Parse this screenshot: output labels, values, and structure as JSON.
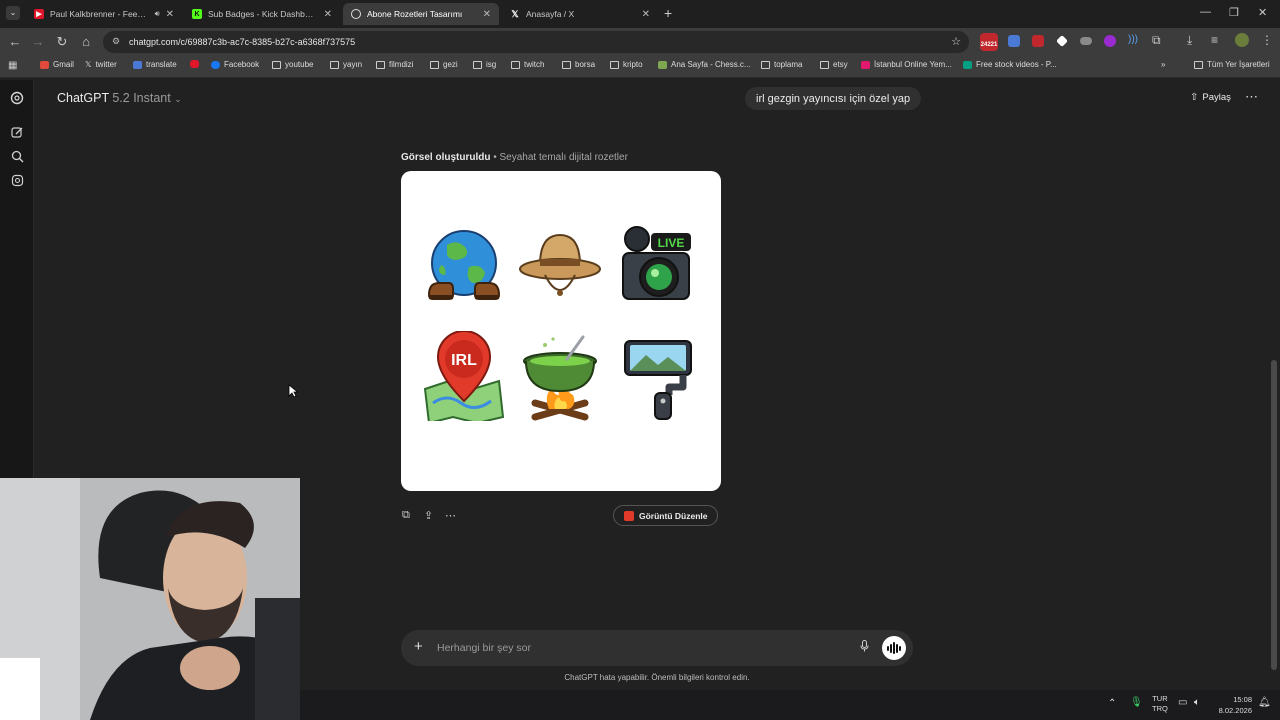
{
  "browser": {
    "tabs": [
      {
        "title": "Paul Kalkbrenner - Feed Yo",
        "favicon_color": "#e0162b",
        "active": false
      },
      {
        "title": "Sub Badges - Kick Dashboard",
        "favicon_color": "#53fc18",
        "active": false
      },
      {
        "title": "Abone Rozetleri Tasarımı",
        "favicon_color": "#ffffff",
        "active": true
      },
      {
        "title": "Anasayfa / X",
        "favicon_color": "#ffffff",
        "active": false
      }
    ],
    "url": "chatgpt.com/c/69887c3b-ac7c-8385-b27c-a6368f737575",
    "extension_badge": "24221",
    "bookmarks": [
      {
        "label": "Gmail",
        "icon": "gmail-icon"
      },
      {
        "label": "twitter",
        "icon": "x-icon"
      },
      {
        "label": "translate",
        "icon": "translate-icon"
      },
      {
        "label": "",
        "icon": "youtube-icon"
      },
      {
        "label": "Facebook",
        "icon": "facebook-icon"
      },
      {
        "label": "youtube",
        "icon": "folder-icon"
      },
      {
        "label": "yayın",
        "icon": "folder-icon"
      },
      {
        "label": "filmdizi",
        "icon": "folder-icon"
      },
      {
        "label": "gezi",
        "icon": "folder-icon"
      },
      {
        "label": "isg",
        "icon": "folder-icon"
      },
      {
        "label": "twitch",
        "icon": "folder-icon"
      },
      {
        "label": "borsa",
        "icon": "folder-icon"
      },
      {
        "label": "kripto",
        "icon": "folder-icon"
      },
      {
        "label": "Ana Sayfa - Chess.c...",
        "icon": "chess-icon"
      },
      {
        "label": "toplama",
        "icon": "folder-icon"
      },
      {
        "label": "etsy",
        "icon": "folder-icon"
      },
      {
        "label": "İstanbul Online Yem...",
        "icon": "yemek-icon"
      },
      {
        "label": "Free stock videos - P...",
        "icon": "pexels-icon"
      }
    ],
    "all_bookmarks": "Tüm Yer İşaretleri"
  },
  "app": {
    "model_name": "ChatGPT",
    "model_version": "5.2 Instant",
    "user_message": "irl gezgin yayıncısı için özel yap",
    "share_label": "Paylaş",
    "image_status": "Görsel oluşturuldu",
    "image_separator": " • ",
    "image_caption": "Seyahat temalı dijital rozetler",
    "badges": [
      {
        "name": "globe-boots",
        "text": ""
      },
      {
        "name": "safari-hat",
        "text": ""
      },
      {
        "name": "camera-live",
        "text": "LIVE"
      },
      {
        "name": "irl-map-pin",
        "text": "IRL"
      },
      {
        "name": "campfire-pot",
        "text": ""
      },
      {
        "name": "phone-gimbal",
        "text": ""
      }
    ],
    "edit_image_label": "Görüntü Düzenle",
    "composer_placeholder": "Herhangi bir şey sor",
    "disclaimer": "ChatGPT hata yapabilir. Önemli bilgileri kontrol edin."
  },
  "taskbar": {
    "lang_top": "TUR",
    "lang_bottom": "TRQ",
    "time": "15:08",
    "date": "8.02.2026"
  }
}
